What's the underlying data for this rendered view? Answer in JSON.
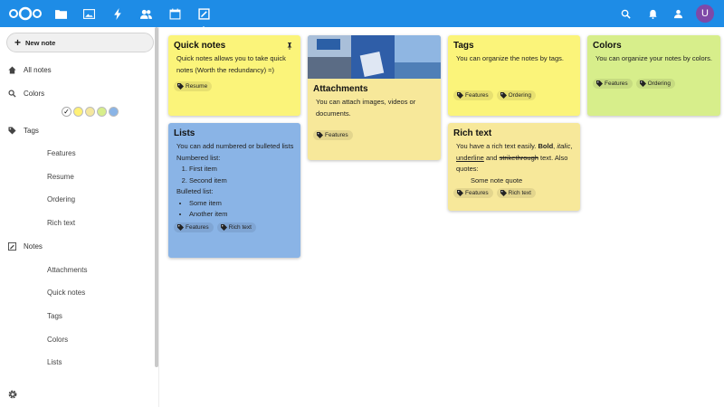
{
  "topbar": {
    "apps": [
      "files-icon",
      "photos-icon",
      "activity-icon",
      "contacts-icon",
      "calendar-icon",
      "notes-icon"
    ],
    "avatar_letter": "U",
    "colors": {
      "bar": "#1e8ce6",
      "avatar": "#7e49a8"
    }
  },
  "sidebar": {
    "new_note": "New note",
    "all_notes": "All notes",
    "colors_label": "Colors",
    "color_swatches": [
      "#ffffff",
      "#fff176",
      "#f5e79e",
      "#d7ee8b",
      "#8ab4e6"
    ],
    "tags_label": "Tags",
    "tags": [
      "Features",
      "Resume",
      "Ordering",
      "Rich text"
    ],
    "notes_label": "Notes",
    "notes": [
      "Attachments",
      "Quick notes",
      "Tags",
      "Colors",
      "Lists"
    ]
  },
  "notes": {
    "quick": {
      "title": "Quick notes",
      "body": "Quick notes allows you to take quick notes (Worth the redundancy) =)",
      "tags": [
        "Resume"
      ],
      "color": "#fbf47a"
    },
    "lists": {
      "title": "Lists",
      "intro": "You can add numbered or bulleted lists",
      "numbered_label": "Numbered list:",
      "numbered": [
        "First item",
        "Second item"
      ],
      "bulleted_label": "Bulleted list:",
      "bulleted": [
        "Some item",
        "Another item"
      ],
      "tags": [
        "Features",
        "Rich text"
      ],
      "color": "#8ab4e6"
    },
    "attachments": {
      "title": "Attachments",
      "body": "You can attach images, videos or documents.",
      "tags": [
        "Features"
      ],
      "color": "#f7e89a"
    },
    "tags_note": {
      "title": "Tags",
      "body": "You can organize the notes by tags.",
      "tags": [
        "Features",
        "Ordering"
      ],
      "color": "#fbf47a"
    },
    "rich": {
      "title": "Rich text",
      "t1": "You have a rich text easily.",
      "bold": "Bold",
      "italic": "italic",
      "underline": "underline",
      "and": "and",
      "strike": "strikethrough",
      "t2": "text. Also quotes:",
      "quote": "Some note quote",
      "tags": [
        "Features",
        "Rich text"
      ],
      "color": "#f7e89a"
    },
    "colors_note": {
      "title": "Colors",
      "body": "You can organize your notes by colors.",
      "tags": [
        "Features",
        "Ordering"
      ],
      "color": "#d7ee8b"
    }
  }
}
